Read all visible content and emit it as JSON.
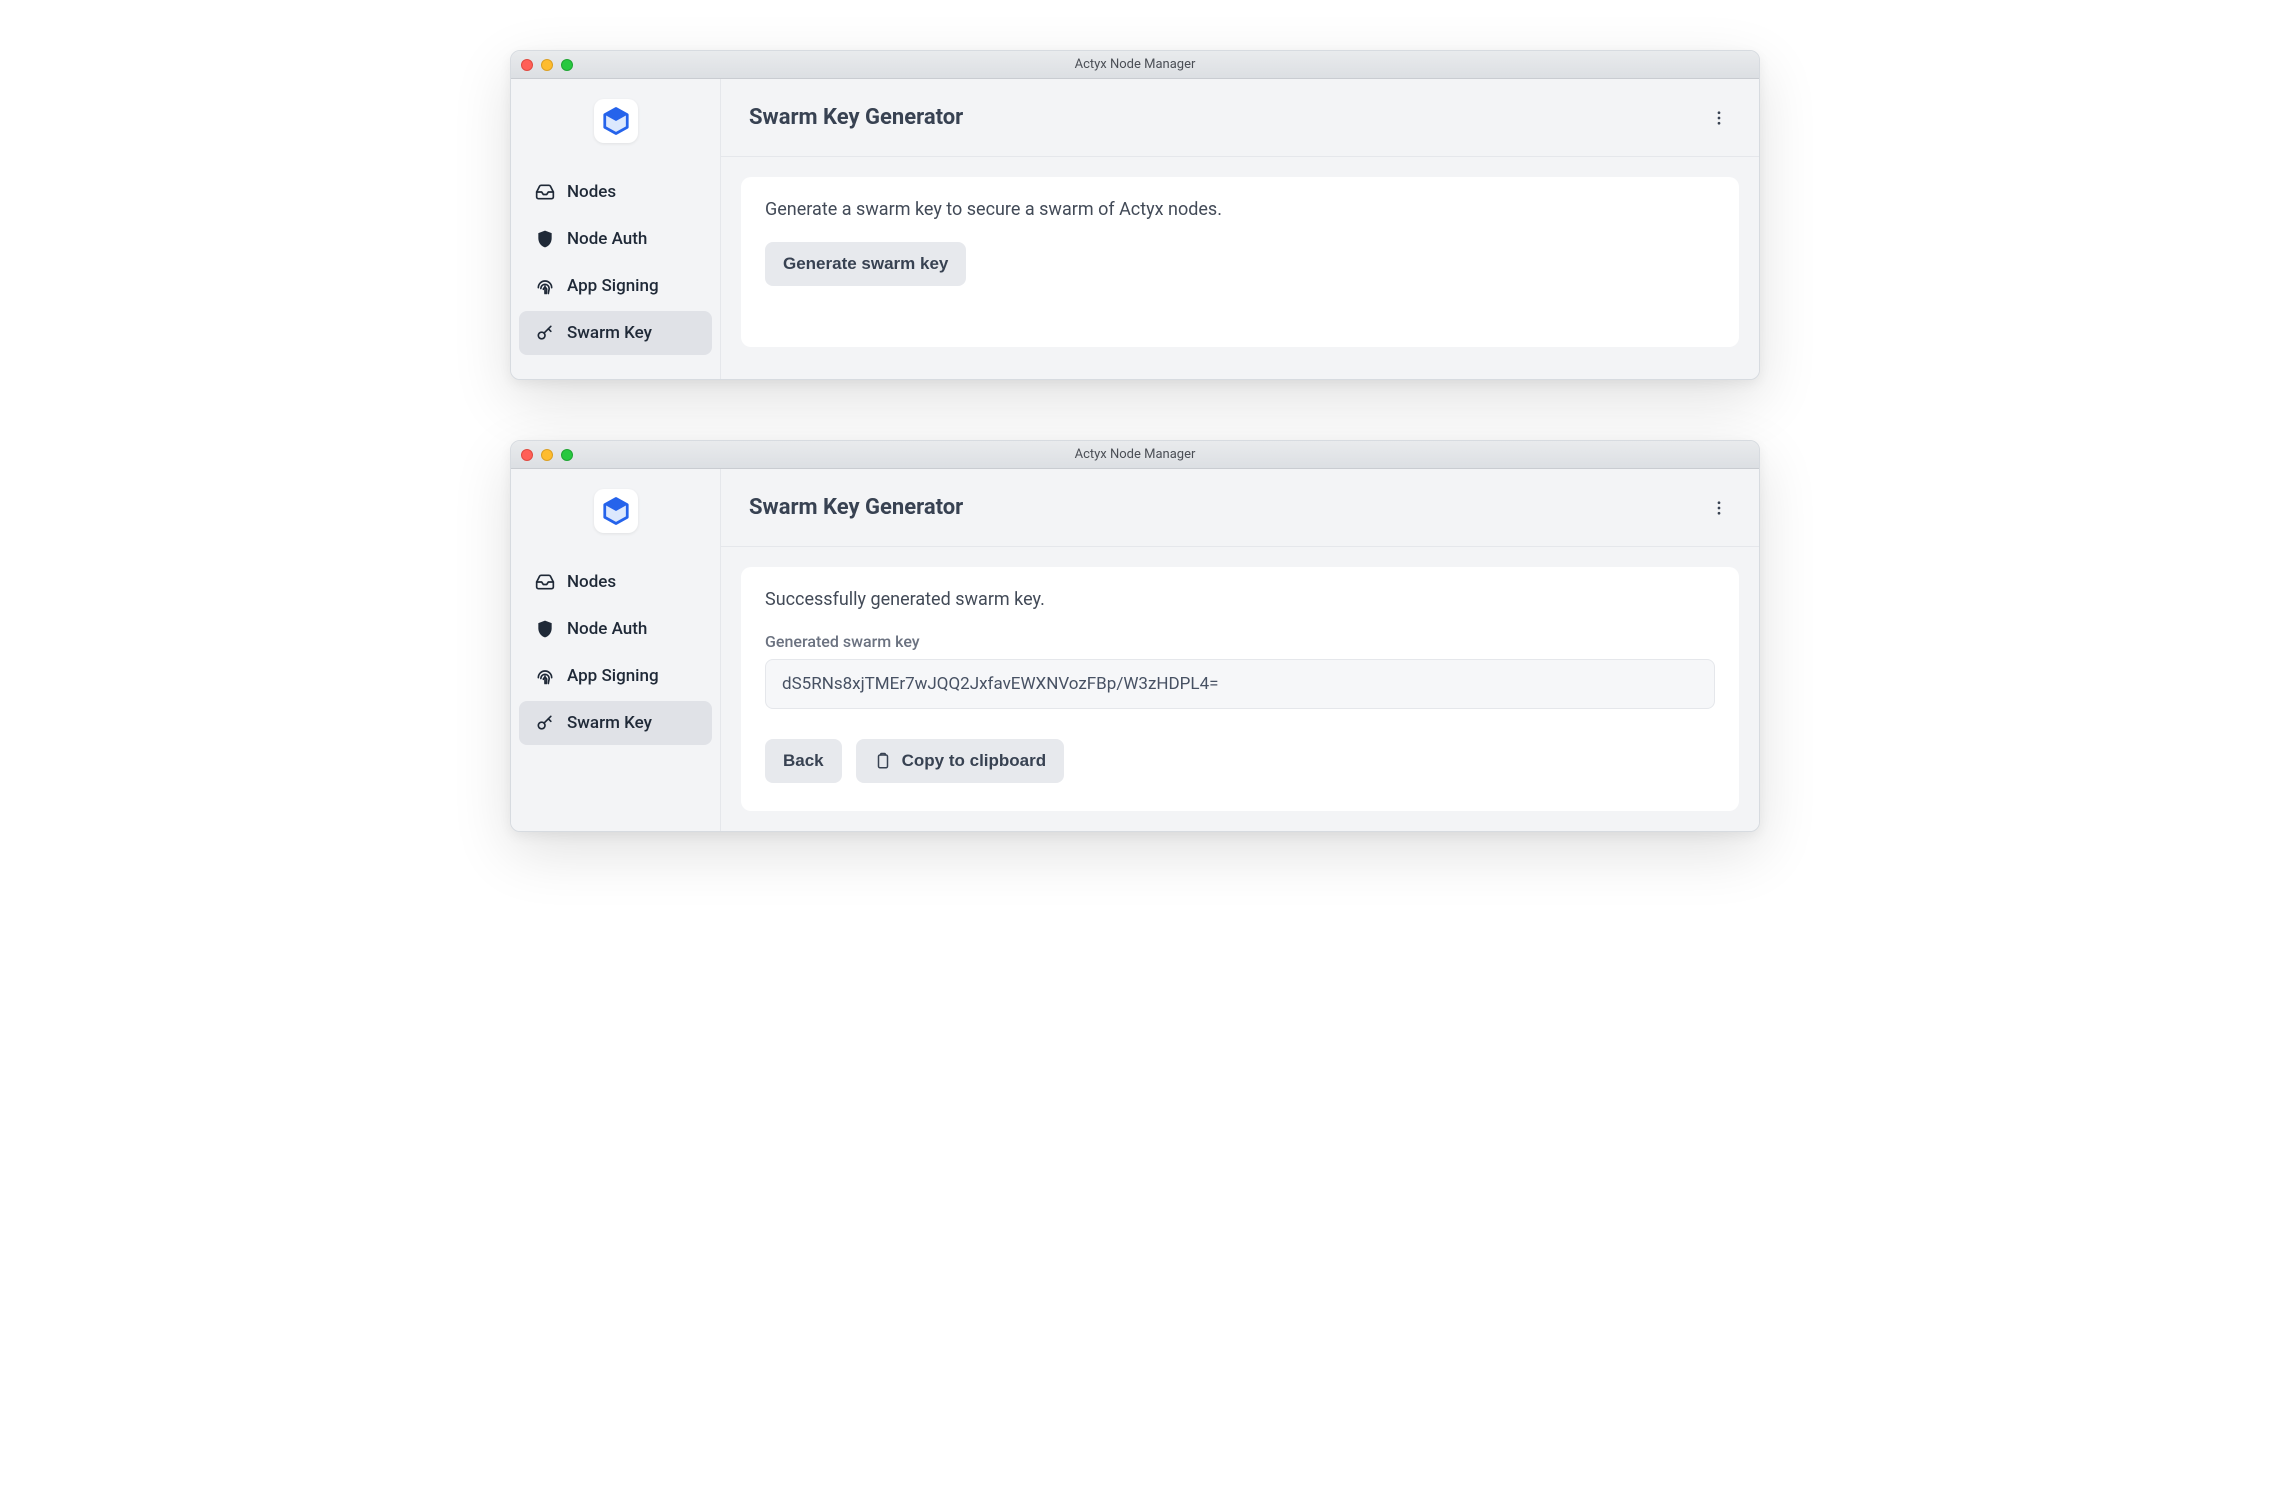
{
  "window_title": "Actyx Node Manager",
  "sidebar": {
    "items": [
      {
        "icon": "inbox-icon",
        "label": "Nodes"
      },
      {
        "icon": "shield-icon",
        "label": "Node Auth"
      },
      {
        "icon": "fingerprint-icon",
        "label": "App Signing"
      },
      {
        "icon": "key-icon",
        "label": "Swarm Key"
      }
    ],
    "active_index": 3
  },
  "page1": {
    "title": "Swarm Key Generator",
    "intro": "Generate a swarm key to secure a swarm of Actyx nodes.",
    "generate_button": "Generate swarm key"
  },
  "page2": {
    "title": "Swarm Key Generator",
    "success_message": "Successfully generated swarm key.",
    "field_label": "Generated swarm key",
    "key_value": "dS5RNs8xjTMEr7wJQQ2JxfavEWXNVozFBp/W3zHDPL4=",
    "back_button": "Back",
    "copy_button": "Copy to clipboard"
  }
}
